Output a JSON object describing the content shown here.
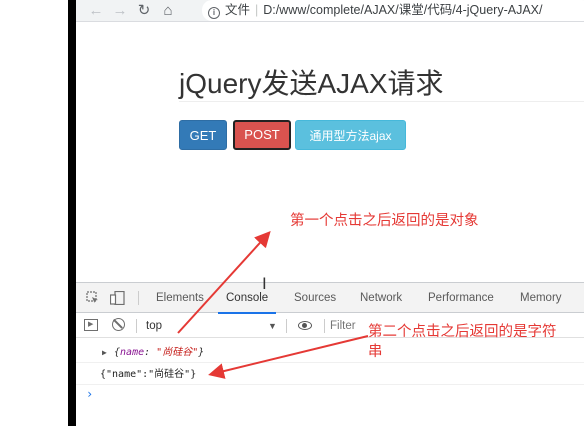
{
  "browser": {
    "nav": {
      "back": "←",
      "forward": "→",
      "reload": "↻",
      "home": "⌂"
    },
    "address": {
      "info": "i",
      "prefix": "文件",
      "separator": "|",
      "url": "D:/www/complete/AJAX/课堂/代码/4-jQuery-AJAX/"
    }
  },
  "page": {
    "title": "jQuery发送AJAX请求",
    "buttons": {
      "get": "GET",
      "post": "POST",
      "ajax": "通用型方法ajax"
    }
  },
  "devtools": {
    "tabs": [
      "Elements",
      "Console",
      "Sources",
      "Network",
      "Performance",
      "Memory"
    ],
    "console_bar": {
      "context": "top",
      "filter_placeholder": "Filter"
    },
    "logs": {
      "row1": {
        "expander": "▶",
        "open": "{",
        "key": "name",
        "colon": ": ",
        "value": "\"尚硅谷\"",
        "close": "}"
      },
      "row2": "{\"name\":\"尚硅谷\"}"
    },
    "prompt": "›"
  },
  "annotations": {
    "first": "第一个点击之后返回的是对象",
    "second": "第二个点击之后返回的是字符串"
  },
  "colors": {
    "annotation": "#e53935",
    "get_button": "#337ab7",
    "post_button": "#d9534f",
    "ajax_button": "#5bc0de",
    "active_tab": "#1a73e8"
  }
}
